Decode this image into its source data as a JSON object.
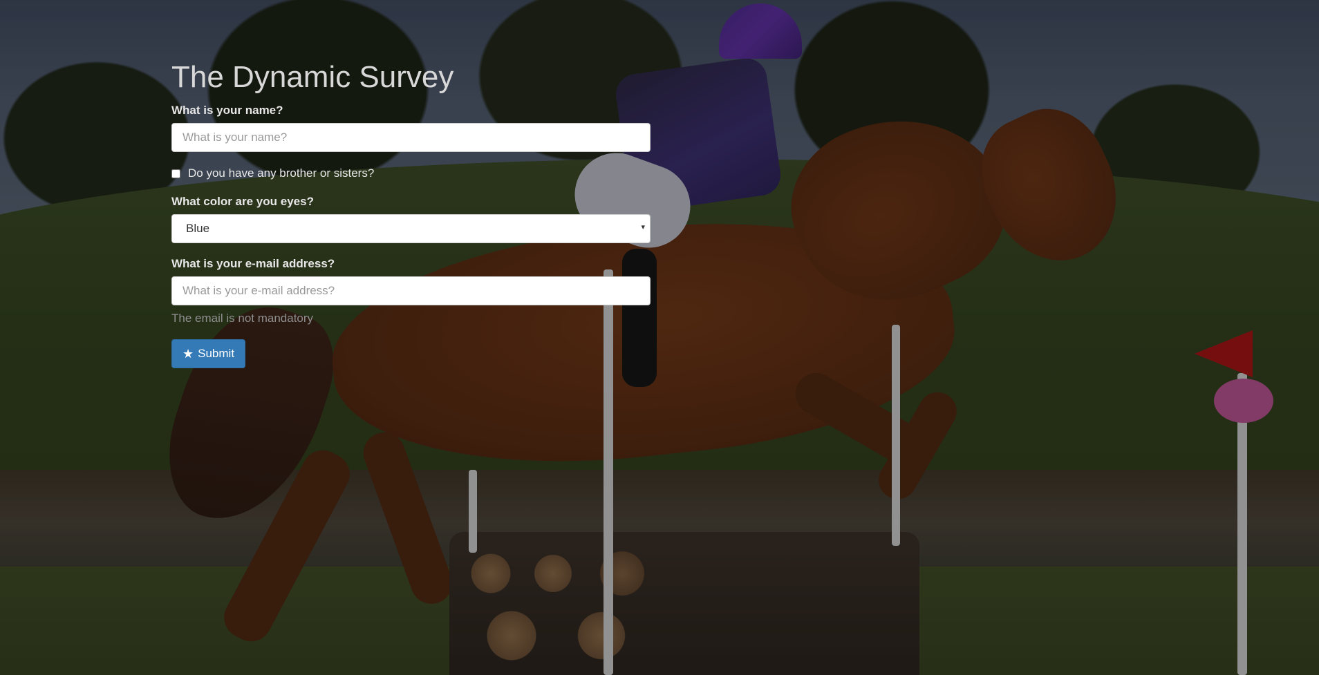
{
  "page": {
    "title": "The Dynamic Survey"
  },
  "form": {
    "name": {
      "label": "What is your name?",
      "placeholder": "What is your name?",
      "value": ""
    },
    "siblings": {
      "label": "Do you have any brother or sisters?",
      "checked": false
    },
    "eye_color": {
      "label": "What color are you eyes?",
      "selected": "Blue"
    },
    "email": {
      "label": "What is your e-mail address?",
      "placeholder": "What is your e-mail address?",
      "value": "",
      "help": "The email is not mandatory"
    },
    "submit": {
      "label": "Submit",
      "icon": "star-icon",
      "color": "#337ab7"
    }
  },
  "colors": {
    "title": "#d8d8d8",
    "label": "#e8e8e8",
    "help": "#8f8f8f"
  }
}
